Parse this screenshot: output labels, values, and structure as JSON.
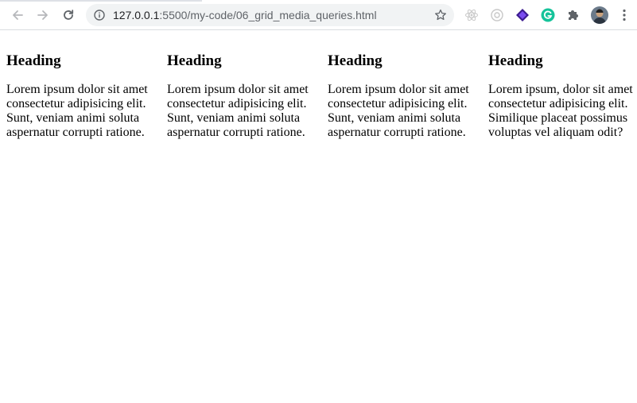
{
  "browser": {
    "url_host": "127.0.0.1",
    "url_path": ":5500/my-code/06_grid_media_queries.html",
    "icons": {
      "back": "arrow-left-icon",
      "forward": "arrow-right-icon",
      "reload": "reload-icon",
      "info": "info-icon",
      "bookmark": "star-icon",
      "extensions": [
        "react-devtools-icon",
        "gear-ext-icon",
        "purple-cube-icon",
        "grammarly-icon",
        "puzzle-icon",
        "profile-avatar-icon",
        "menu-dots-icon"
      ]
    },
    "colors": {
      "grammarly": "#15c39a",
      "purple_ext": "#5b2bd1",
      "omnibox_bg": "#f1f3f4"
    }
  },
  "page": {
    "cards": [
      {
        "heading": "Heading",
        "text": "Lorem ipsum dolor sit amet consectetur adipisicing elit. Sunt, veniam animi soluta aspernatur corrupti ratione."
      },
      {
        "heading": "Heading",
        "text": "Lorem ipsum dolor sit amet consectetur adipisicing elit. Sunt, veniam animi soluta aspernatur corrupti ratione."
      },
      {
        "heading": "Heading",
        "text": "Lorem ipsum dolor sit amet consectetur adipisicing elit. Sunt, veniam animi soluta aspernatur corrupti ratione."
      },
      {
        "heading": "Heading",
        "text": "Lorem ipsum, dolor sit amet consectetur adipisicing elit. Similique placeat possimus voluptas vel aliquam odit?"
      }
    ]
  }
}
